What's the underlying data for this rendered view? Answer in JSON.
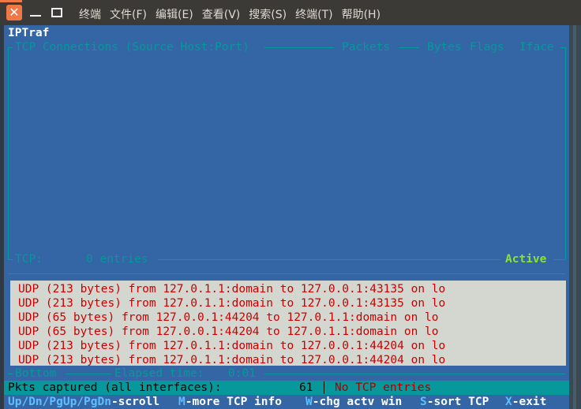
{
  "window": {
    "menu": [
      "终端",
      "文件(F)",
      "编辑(E)",
      "查看(V)",
      "搜索(S)",
      "终端(T)",
      "帮助(H)"
    ]
  },
  "app": {
    "name": "IPTraf",
    "tcp_header": {
      "connections": "TCP Connections (Source Host:Port)",
      "packets": "Packets",
      "bytes": "Bytes",
      "flags": "Flags",
      "iface": "Iface"
    },
    "tcp_footer": {
      "label": "TCP:",
      "entries": "0 entries",
      "state": "Active"
    },
    "udp_lines": [
      "UDP (213 bytes) from 127.0.1.1:domain to 127.0.0.1:43135 on lo",
      "UDP (213 bytes) from 127.0.1.1:domain to 127.0.0.1:43135 on lo",
      "UDP (65 bytes) from 127.0.0.1:44204 to 127.0.1.1:domain on lo",
      "UDP (65 bytes) from 127.0.0.1:44204 to 127.0.1.1:domain on lo",
      "UDP (213 bytes) from 127.0.1.1:domain to 127.0.0.1:44204 on lo",
      "UDP (213 bytes) from 127.0.1.1:domain to 127.0.0.1:44204 on lo"
    ],
    "bottom_bar": {
      "position": "Bottom",
      "elapsed_label": "Elapsed time:",
      "elapsed_value": "0:01"
    },
    "status": {
      "captured_label": "Pkts captured (all interfaces):",
      "captured_value": "61",
      "tcp_message": "No TCP entries"
    },
    "help": [
      {
        "key": "Up/Dn/PgUp/PgDn",
        "text": "-scroll"
      },
      {
        "key": "M",
        "text": "-more TCP info"
      },
      {
        "key": "W",
        "text": "-chg actv win"
      },
      {
        "key": "S",
        "text": "-sort TCP"
      },
      {
        "key": "X",
        "text": "-exit"
      }
    ]
  }
}
